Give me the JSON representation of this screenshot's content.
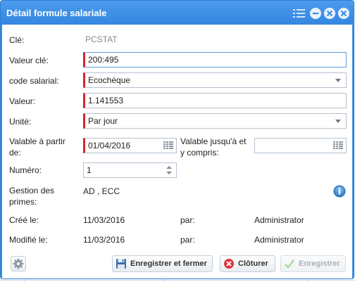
{
  "window": {
    "title": "Détail formule salariale"
  },
  "form": {
    "cle": {
      "label": "Clé:",
      "value": "PCSTAT"
    },
    "valeur_cle": {
      "label": "Valeur clé:",
      "value": "200:495"
    },
    "code_salarial": {
      "label": "code salarial:",
      "value": "Ecochèque"
    },
    "valeur": {
      "label": "Valeur:",
      "value": "1.141553"
    },
    "unite": {
      "label": "Unité:",
      "value": "Par jour"
    },
    "valable_a_partir": {
      "label_line1": "Valable à partir",
      "label_line2": "de:",
      "value": "01/04/2016"
    },
    "valable_jusqua": {
      "label_line1": "Valable jusqu'à et",
      "label_line2": "y compris:",
      "value": ""
    },
    "numero": {
      "label": "Numéro:",
      "value": "1"
    },
    "gestion_primes": {
      "label_line1": "Gestion des",
      "label_line2": "primes:",
      "value": "AD , ECC"
    },
    "cree_le": {
      "label": "Créé le:",
      "date": "11/03/2016",
      "par_label": "par:",
      "user": "Administrator"
    },
    "modifie_le": {
      "label": "Modifié le:",
      "date": "11/03/2016",
      "par_label": "par:",
      "user": "Administrator"
    }
  },
  "buttons": {
    "save_close": "Enregistrer et fermer",
    "close": "Clôturer",
    "save": "Enregistrer"
  },
  "colors": {
    "titlebar": "#3a8ee6",
    "required_marker": "#d9232e",
    "close_icon": "#e2323a",
    "save_check": "#7cc576"
  },
  "icons": {
    "grip": "grip-icon",
    "minimize": "minimize-icon",
    "restore": "restore-icon",
    "close": "close-icon",
    "calendar": "calendar-icon",
    "dropdown": "chevron-down-icon",
    "spinner": "spinner-icon",
    "info": "info-icon",
    "gear": "gear-icon",
    "floppy": "floppy-icon",
    "cancel": "cancel-icon",
    "check": "check-icon"
  }
}
